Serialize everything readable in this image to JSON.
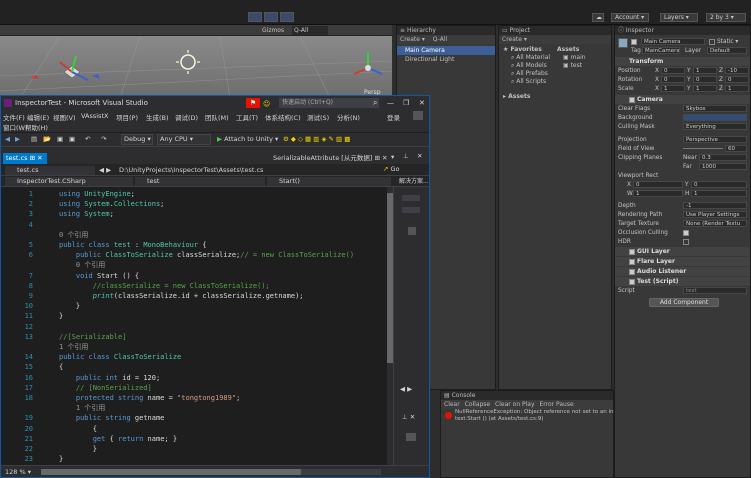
{
  "unity": {
    "account": "Account",
    "layers": "Layers",
    "layout": "2 by 3",
    "scene_toolbar": {
      "gizmos": "Gizmos",
      "search": "Q-All"
    },
    "persp": "Persp"
  },
  "hierarchy": {
    "tab": "Hierarchy",
    "create": "Create",
    "search": "Q-All",
    "items": [
      "Main Camera",
      "Directional Light"
    ]
  },
  "project": {
    "tab": "Project",
    "create": "Create",
    "favorites": "Favorites",
    "favorite_items": [
      "All Material",
      "All Models",
      "All Prefabs",
      "All Scripts"
    ],
    "assets_header": "Assets",
    "asset_files": [
      "main",
      "test"
    ],
    "assets_folder": "Assets"
  },
  "console": {
    "tab": "Console",
    "buttons": [
      "Clear",
      "Collapse",
      "Clear on Play",
      "Error Pause"
    ],
    "error_line1": "NullReferenceException: Object reference not set to an instance of an object",
    "error_line2": "test.Start () (at Assets/test.cs:9)"
  },
  "inspector": {
    "tab": "Inspector",
    "object_name": "Main Camera",
    "static": "Static",
    "tag_label": "Tag",
    "tag": "MainCamera",
    "layer_label": "Layer",
    "layer": "Default",
    "transform": "Transform",
    "position": {
      "label": "Position",
      "x": "0",
      "y": "1",
      "z": "-10"
    },
    "rotation": {
      "label": "Rotation",
      "x": "0",
      "y": "0",
      "z": "0"
    },
    "scale": {
      "label": "Scale",
      "x": "1",
      "y": "1",
      "z": "1"
    },
    "camera": "Camera",
    "clear_flags": {
      "label": "Clear Flags",
      "value": "Skybox"
    },
    "background": "Background",
    "culling_mask": {
      "label": "Culling Mask",
      "value": "Everything"
    },
    "projection": {
      "label": "Projection",
      "value": "Perspective"
    },
    "fov": {
      "label": "Field of View",
      "value": "60"
    },
    "clipping": {
      "label": "Clipping Planes",
      "near_label": "Near",
      "near": "0.3",
      "far_label": "Far",
      "far": "1000"
    },
    "viewport": "Viewport Rect",
    "vp": {
      "x": "0",
      "y": "0",
      "w": "1",
      "h": "1"
    },
    "depth": {
      "label": "Depth",
      "value": "-1"
    },
    "rendering_path": {
      "label": "Rendering Path",
      "value": "Use Player Settings"
    },
    "target_texture": {
      "label": "Target Texture",
      "value": "None (Render Textu"
    },
    "occlusion": "Occlusion Culling",
    "hdr": "HDR",
    "components": [
      "GUI Layer",
      "Flare Layer",
      "Audio Listener",
      "Test (Script)"
    ],
    "script_label": "Script",
    "script_value": "test",
    "add_component": "Add Component"
  },
  "vs": {
    "title": "InspectorTest - Microsoft Visual Studio",
    "quick_launch": "快速启动 (Ctrl+Q)",
    "login": "登录",
    "menu": [
      "文件(F)",
      "编辑(E)",
      "视图(V)",
      "VAssistX",
      "项目(P)",
      "生成(B)",
      "调试(D)",
      "团队(M)",
      "工具(T)",
      "体系结构(C)",
      "测试(S)",
      "分析(N)"
    ],
    "menu2": [
      "窗口(W)",
      "帮助(H)"
    ],
    "debug": "Debug",
    "cpu": "Any CPU",
    "attach": "Attach to Unity",
    "tab": "test.cs",
    "nav_tab": "test.cs",
    "path": "D:\\UnityProjects\\InspectorTest\\Assets\\test.cs",
    "serializable": "SerializableAttribute [从元数据]",
    "go": "Go",
    "project_combo": "InspectorTest.CSharp",
    "class_combo": "test",
    "member_combo": "Start()",
    "zoom": "128 %",
    "solution_label": "解决方案..."
  },
  "code": [
    {
      "n": "1",
      "t": "using UnityEngine;"
    },
    {
      "n": "2",
      "t": "using System.Collections;"
    },
    {
      "n": "3",
      "t": "using System;"
    },
    {
      "n": "4",
      "t": ""
    },
    {
      "n": "",
      "t": "0 个引用"
    },
    {
      "n": "5",
      "t": "public class test : MonoBehaviour {"
    },
    {
      "n": "6",
      "t": "    public ClassToSerialize classSerialize;// = new ClassToSerialize()"
    },
    {
      "n": "",
      "t": "    0 个引用"
    },
    {
      "n": "7",
      "t": "    void Start () {"
    },
    {
      "n": "8",
      "t": "        //classSerialize = new ClassToSerialize();"
    },
    {
      "n": "9",
      "t": "        print(classSerialize.id + classSerialize.getname);"
    },
    {
      "n": "10",
      "t": "    }"
    },
    {
      "n": "11",
      "t": "}"
    },
    {
      "n": "12",
      "t": ""
    },
    {
      "n": "13",
      "t": "//[Serializable]"
    },
    {
      "n": "",
      "t": "1 个引用"
    },
    {
      "n": "14",
      "t": "public class ClassToSerialize"
    },
    {
      "n": "15",
      "t": "{"
    },
    {
      "n": "16",
      "t": "    public int id = 120;"
    },
    {
      "n": "17",
      "t": "    // [NonSerialized]"
    },
    {
      "n": "18",
      "t": "    protected string name = \"tongtong1989\";"
    },
    {
      "n": "",
      "t": "    1 个引用"
    },
    {
      "n": "19",
      "t": "    public string getname"
    },
    {
      "n": "20",
      "t": "        {"
    },
    {
      "n": "21",
      "t": "        get { return name; }"
    },
    {
      "n": "22",
      "t": "        }"
    },
    {
      "n": "23",
      "t": "}"
    },
    {
      "n": "24",
      "t": ""
    }
  ],
  "colors": {
    "vs_accent": "#0e5aa7",
    "keyword": "#569cd6",
    "type": "#4ec9b0",
    "comment": "#57a64a",
    "string": "#d69d85",
    "error": "#e51400"
  }
}
